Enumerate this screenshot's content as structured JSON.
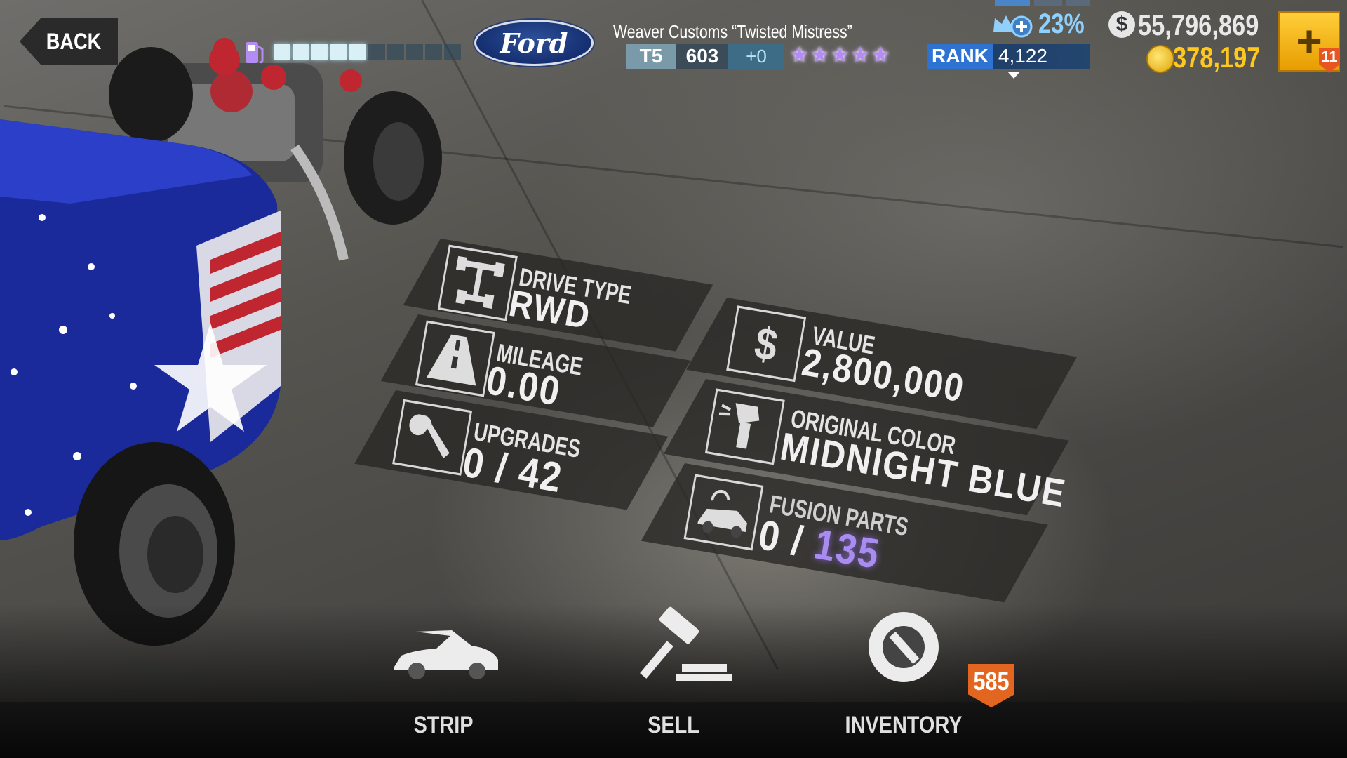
{
  "header": {
    "back_label": "BACK",
    "fuel": {
      "filled": 5,
      "total": 10
    },
    "manufacturer_logo_text": "Ford",
    "car_name": "Weaver Customs “Twisted Mistress”",
    "tier": "T5",
    "performance": "603",
    "performance_delta": "+0",
    "stars": 5,
    "rank_label": "RANK",
    "rank_value": "4,122",
    "crew_percent": "23%",
    "cash_symbol": "$",
    "cash": "55,796,869",
    "gold": "378,197",
    "plus_label": "+",
    "plus_badge": "11"
  },
  "stats": {
    "drive_type": {
      "label": "DRIVE TYPE",
      "value": "RWD"
    },
    "mileage": {
      "label": "MILEAGE",
      "value": "0.00"
    },
    "upgrades": {
      "label": "UPGRADES",
      "value": "0 / 42"
    },
    "value": {
      "label": "VALUE",
      "value": "2,800,000",
      "icon_symbol": "$"
    },
    "original_color": {
      "label": "ORIGINAL COLOR",
      "value": "MIDNIGHT BLUE"
    },
    "fusion_parts": {
      "label": "FUSION PARTS",
      "value_prefix": "0 / ",
      "value_highlight": "135"
    }
  },
  "bottom_nav": {
    "strip": "STRIP",
    "sell": "SELL",
    "inventory": "INVENTORY",
    "inventory_badge": "585"
  },
  "colors": {
    "accent_gold": "#ffc81f",
    "rank_blue": "#2f73d2",
    "star_purple": "#b58cf5",
    "fusion_highlight": "#a98cf0",
    "badge_orange": "#e2661f"
  },
  "icons": [
    "back-arrow-icon",
    "fuel-pump-icon",
    "ford-logo",
    "star-icon",
    "crew-icon",
    "cash-icon",
    "gold-coin-icon",
    "drivetrain-icon",
    "road-icon",
    "wrench-icon",
    "dollar-icon",
    "spray-gun-icon",
    "fusion-car-icon",
    "car-strip-icon",
    "gavel-icon",
    "inventory-wrench-icon"
  ]
}
